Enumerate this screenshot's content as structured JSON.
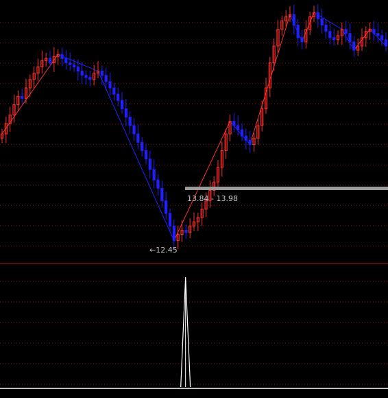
{
  "chart_data": [
    {
      "type": "candlestick",
      "panel": "price",
      "up_color": "#ff3030",
      "down_color": "#2020ff",
      "grid": "dotted horizontal red",
      "series": [
        {
          "name": "",
          "values": [
            15.1,
            15.35,
            15.55,
            15.8,
            16.0,
            15.95,
            16.2,
            16.4,
            16.55,
            16.7,
            16.85,
            16.9,
            16.8,
            16.95,
            17.0,
            16.9,
            16.8,
            16.75,
            16.7,
            16.6,
            16.5,
            16.45,
            16.4,
            16.55,
            16.6,
            16.5,
            16.35,
            16.2,
            16.05,
            15.9,
            15.7,
            15.5,
            15.3,
            15.1,
            14.9,
            14.7,
            14.5,
            14.25,
            14.0,
            13.8,
            13.5,
            13.2,
            12.9,
            12.55,
            12.7,
            12.8,
            12.75,
            12.9,
            13.0,
            13.1,
            13.3,
            13.5,
            13.75,
            13.95,
            14.3,
            14.7,
            15.1,
            15.4,
            15.3,
            15.2,
            15.05,
            14.95,
            14.85,
            15.0,
            15.3,
            15.7,
            16.2,
            16.8,
            17.2,
            17.6,
            17.8,
            17.9,
            17.95,
            17.7,
            17.4,
            17.3,
            17.6,
            17.9,
            18.0,
            17.85,
            17.7,
            17.55,
            17.4,
            17.35,
            17.45,
            17.6,
            17.5,
            17.3,
            17.1,
            17.2,
            17.4,
            17.55,
            17.6,
            17.5,
            17.45,
            17.35,
            17.2
          ]
        }
      ],
      "annotations": [
        {
          "text": "←12.45",
          "value": 12.45
        },
        {
          "text": "13.84 - 13.98",
          "range": [
            13.84,
            13.98
          ]
        }
      ]
    },
    {
      "type": "line",
      "panel": "indicator",
      "line_color": "#ffffff",
      "series": [
        {
          "name": "",
          "spike_index": 44,
          "peak": 1.0,
          "baseline": 0.0
        }
      ]
    }
  ]
}
